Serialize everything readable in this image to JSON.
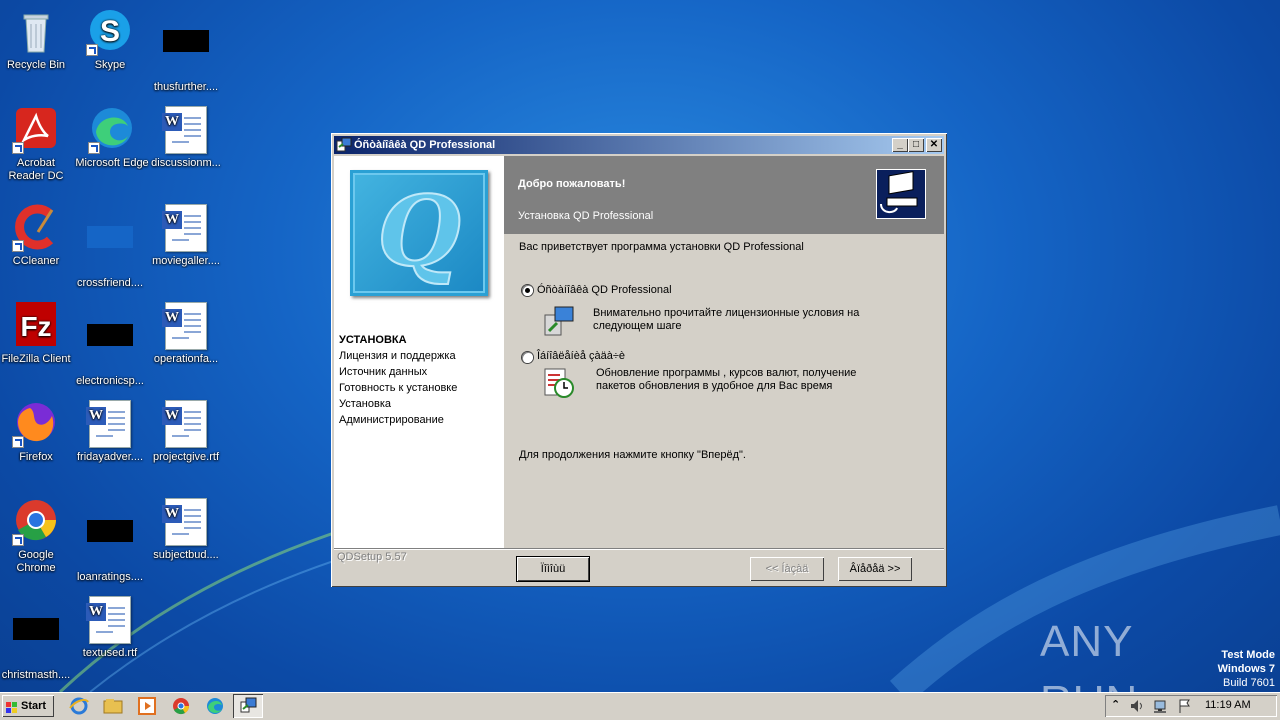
{
  "desktop": {
    "icons": [
      {
        "label": "Recycle Bin",
        "icon": "recycle-bin-icon"
      },
      {
        "label": "Skype",
        "icon": "skype-icon"
      },
      {
        "label": "thusfurther....",
        "icon": "hidden-file-icon"
      },
      {
        "label": "Acrobat Reader DC",
        "icon": "acrobat-icon"
      },
      {
        "label": "Microsoft Edge",
        "icon": "edge-icon"
      },
      {
        "label": "discussionm...",
        "icon": "word-doc-icon"
      },
      {
        "label": "CCleaner",
        "icon": "ccleaner-icon"
      },
      {
        "label": "crossfriend....",
        "icon": "hidden-file-icon"
      },
      {
        "label": "moviegaller....",
        "icon": "word-doc-icon"
      },
      {
        "label": "FileZilla Client",
        "icon": "filezilla-icon"
      },
      {
        "label": "electronicsp...",
        "icon": "hidden-file-icon"
      },
      {
        "label": "operationfa...",
        "icon": "word-doc-icon"
      },
      {
        "label": "Firefox",
        "icon": "firefox-icon"
      },
      {
        "label": "fridayadver....",
        "icon": "word-doc-icon"
      },
      {
        "label": "projectgive.rtf",
        "icon": "word-doc-icon"
      },
      {
        "label": "Google Chrome",
        "icon": "chrome-icon"
      },
      {
        "label": "loanratings....",
        "icon": "hidden-file-icon"
      },
      {
        "label": "subjectbud....",
        "icon": "word-doc-icon"
      },
      {
        "label": "christmasth....",
        "icon": "hidden-file-icon"
      },
      {
        "label": "textused.rtf",
        "icon": "word-doc-icon"
      }
    ]
  },
  "window": {
    "title": "Óñòàíîâêà QD Professional",
    "minimize": "_",
    "maximize": "□",
    "close": "✕",
    "logo_letter": "Q",
    "steps": [
      "УСТАНОВКА",
      "Лицензия и поддержка",
      "Источник данных",
      "Готовность к установке",
      "Установка",
      "Администрирование"
    ],
    "header_title": "Добро пожаловать!",
    "header_subtitle": "Установка QD Professional",
    "intro": "Вас приветствует программа установки QD Professional",
    "option1_label": "Óñòàíîâêà QD Professional",
    "option1_desc": "Внимательно прочитайте лицензионные условия на следующем шаге",
    "option2_label": "Îáíîâëåíèå çàäà÷è",
    "option2_desc": "Обновление программы , курсов валют, получение пакетов обновления в удобное для Вас время",
    "continue_text": "Для продолжения нажмите кнопку \"Вперёд\".",
    "version": "QDSetup 5.57",
    "btn_help": "Ïîìîùü",
    "btn_back": "<< Íàçàä",
    "btn_next": "Âïåðåä >>"
  },
  "taskbar": {
    "start": "Start",
    "clock": "11:19 AM"
  },
  "watermark": {
    "line1": "Test Mode",
    "line2": "Windows 7",
    "line3": "Build 7601",
    "brand": "ANY RUN"
  }
}
